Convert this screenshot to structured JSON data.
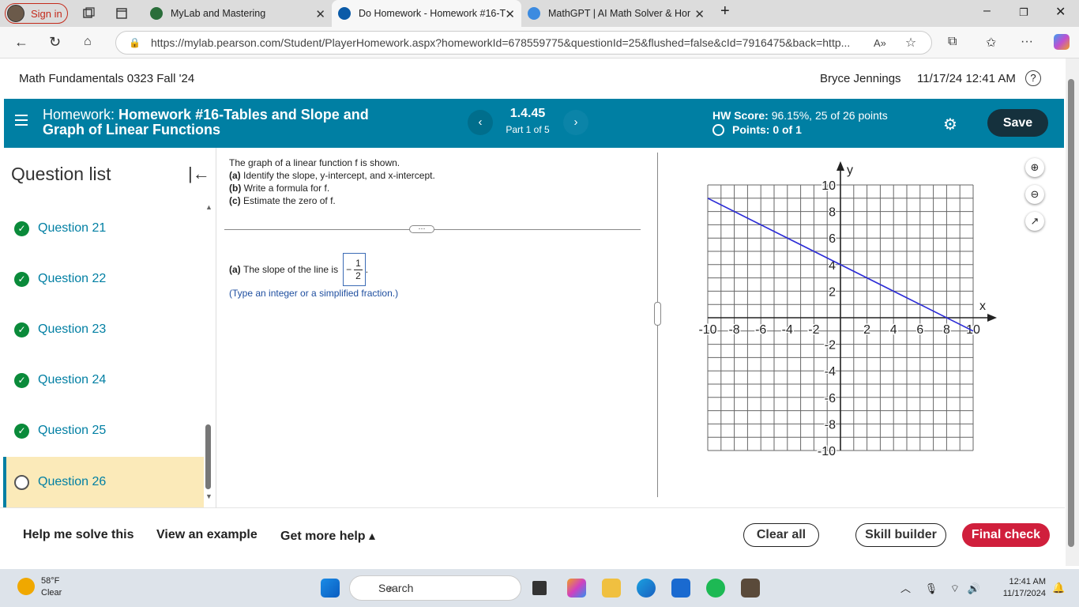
{
  "browser": {
    "signin_label": "Sign in",
    "tabs": [
      {
        "title": "MyLab and Mastering"
      },
      {
        "title": "Do Homework - Homework #16-T"
      },
      {
        "title": "MathGPT | AI Math Solver & Hom"
      }
    ],
    "url": "https://mylab.pearson.com/Student/PlayerHomework.aspx?homeworkId=678559775&questionId=25&flushed=false&cId=7916475&back=http..."
  },
  "header": {
    "course": "Math Fundamentals 0323 Fall '24",
    "user": "Bryce Jennings",
    "datetime": "11/17/24 12:41 AM",
    "help": "?"
  },
  "hwbar": {
    "label": "Homework:",
    "title": "Homework #16-Tables and Slope and Graph of Linear Functions",
    "question_number": "1.4.45",
    "part": "Part 1 of 5",
    "hw_score_label": "HW Score:",
    "hw_score_value": "96.15%, 25 of 26 points",
    "points": "Points: 0 of 1",
    "save_label": "Save"
  },
  "question_list": {
    "title": "Question list",
    "items": [
      {
        "label": "Question 21",
        "status": "complete"
      },
      {
        "label": "Question 22",
        "status": "complete"
      },
      {
        "label": "Question 23",
        "status": "complete"
      },
      {
        "label": "Question 24",
        "status": "complete"
      },
      {
        "label": "Question 25",
        "status": "complete"
      },
      {
        "label": "Question 26",
        "status": "current"
      }
    ]
  },
  "question": {
    "intro": "The graph of a linear function f is shown.",
    "parts": [
      {
        "tag": "(a)",
        "text": "Identify the slope, y-intercept, and x-intercept."
      },
      {
        "tag": "(b)",
        "text": "Write a formula for f."
      },
      {
        "tag": "(c)",
        "text": "Estimate the zero of f."
      }
    ],
    "answer_tag": "(a)",
    "answer_text": "The slope of the line is",
    "answer_sign": "−",
    "answer_num": "1",
    "answer_den": "2",
    "answer_end": ".",
    "hint": "(Type an integer or a simplified fraction.)"
  },
  "graph": {
    "xlabel": "x",
    "ylabel": "y",
    "xrange": [
      -10,
      10
    ],
    "yrange": [
      -10,
      10
    ],
    "grid_step": 1,
    "x_ticks": [
      -10,
      -8,
      -6,
      -4,
      -2,
      2,
      4,
      6,
      8,
      10
    ],
    "y_ticks": [
      10,
      8,
      6,
      4,
      2,
      -2,
      -4,
      -6,
      -8,
      -10
    ],
    "line": {
      "slope": -0.5,
      "intercept": 4,
      "color": "#2b2bd6"
    }
  },
  "footer": {
    "help_solve": "Help me solve this",
    "example": "View an example",
    "more_help": "Get more help ▴",
    "clear_all": "Clear all",
    "skill_builder": "Skill builder",
    "final_check": "Final check"
  },
  "taskbar": {
    "temp": "58°F",
    "condition": "Clear",
    "search": "Search",
    "time": "12:41 AM",
    "date": "11/17/2024"
  },
  "colors": {
    "brand": "#007fa3",
    "save": "#15313d",
    "final_check": "#d01f3c",
    "complete": "#0a8a3a",
    "current_bg": "#fbeab9"
  }
}
